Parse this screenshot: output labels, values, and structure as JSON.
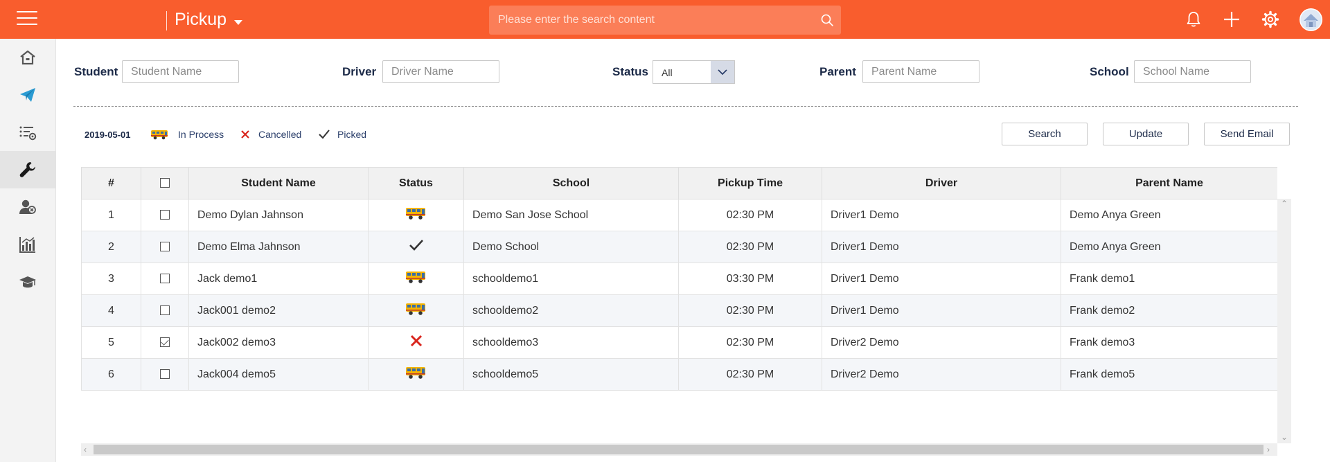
{
  "header": {
    "app_title": "Pickup",
    "search_placeholder": "Please enter the search content"
  },
  "icons": {
    "menu": "hamburger-icon",
    "search": "search-icon",
    "notifications": "bell-icon",
    "add": "plus-icon",
    "settings": "gear-icon",
    "profile": "avatar"
  },
  "sidebar": {
    "items": [
      {
        "icon": "home-icon",
        "active": false
      },
      {
        "icon": "paper-plane-icon",
        "active": false
      },
      {
        "icon": "list-settings-icon",
        "active": false
      },
      {
        "icon": "wrench-icon",
        "active": true
      },
      {
        "icon": "user-group-icon",
        "active": false
      },
      {
        "icon": "bar-chart-icon",
        "active": false
      },
      {
        "icon": "graduation-cap-icon",
        "active": false
      }
    ]
  },
  "filters": {
    "student_label": "Student",
    "student_placeholder": "Student Name",
    "driver_label": "Driver",
    "driver_placeholder": "Driver Name",
    "status_label": "Status",
    "status_value": "All",
    "parent_label": "Parent",
    "parent_placeholder": "Parent Name",
    "school_label": "School",
    "school_placeholder": "School Name"
  },
  "legend": {
    "date": "2019-05-01",
    "in_process": "In Process",
    "cancelled": "Cancelled",
    "picked": "Picked"
  },
  "actions": {
    "search": "Search",
    "update": "Update",
    "send_email": "Send Email"
  },
  "table": {
    "columns": [
      "#",
      "",
      "Student Name",
      "Status",
      "School",
      "Pickup Time",
      "Driver",
      "Parent Name"
    ],
    "rows": [
      {
        "num": "1",
        "checked": false,
        "student": "Demo Dylan Jahnson",
        "status": "in_process",
        "school": "Demo San Jose School",
        "time": "02:30 PM",
        "driver": "Driver1 Demo",
        "parent": "Demo Anya Green"
      },
      {
        "num": "2",
        "checked": false,
        "student": "Demo Elma Jahnson",
        "status": "picked",
        "school": "Demo School",
        "time": "02:30 PM",
        "driver": "Driver1 Demo",
        "parent": "Demo Anya Green"
      },
      {
        "num": "3",
        "checked": false,
        "student": "Jack demo1",
        "status": "in_process",
        "school": "schooldemo1",
        "time": "03:30 PM",
        "driver": "Driver1 Demo",
        "parent": "Frank demo1"
      },
      {
        "num": "4",
        "checked": false,
        "student": "Jack001 demo2",
        "status": "in_process",
        "school": "schooldemo2",
        "time": "02:30 PM",
        "driver": "Driver1 Demo",
        "parent": "Frank demo2"
      },
      {
        "num": "5",
        "checked": true,
        "student": "Jack002 demo3",
        "status": "cancelled",
        "school": "schooldemo3",
        "time": "02:30 PM",
        "driver": "Driver2 Demo",
        "parent": "Frank demo3"
      },
      {
        "num": "6",
        "checked": false,
        "student": "Jack004 demo5",
        "status": "in_process",
        "school": "schooldemo5",
        "time": "02:30 PM",
        "driver": "Driver2 Demo",
        "parent": "Frank demo5"
      }
    ]
  },
  "colors": {
    "brand": "#f95d2d",
    "cancel": "#d9251d",
    "bus": "#f4b400"
  }
}
